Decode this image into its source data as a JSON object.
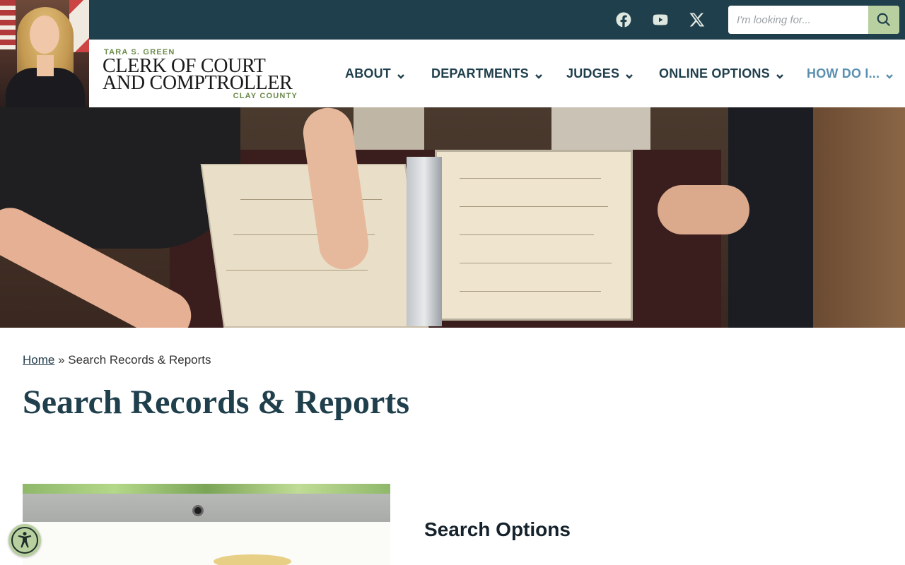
{
  "topbar": {
    "social": [
      {
        "name": "facebook-icon"
      },
      {
        "name": "youtube-icon"
      },
      {
        "name": "x-icon"
      }
    ],
    "search": {
      "placeholder": "I'm looking for...",
      "value": "",
      "button_icon": "search-icon"
    }
  },
  "header": {
    "portrait_icon": "clerk-portrait",
    "logo": {
      "name_line": "TARA S. GREEN",
      "title_line_1": "CLERK OF COURT",
      "title_line_2": "AND COMPTROLLER",
      "county_line": "CLAY COUNTY"
    },
    "nav": [
      {
        "label": "ABOUT",
        "icon": "chevron-down-icon"
      },
      {
        "label": "DEPARTMENTS",
        "icon": "chevron-down-icon"
      },
      {
        "label": "JUDGES",
        "icon": "chevron-down-icon"
      },
      {
        "label": "ONLINE OPTIONS",
        "icon": "chevron-down-icon"
      },
      {
        "label": "HOW DO I...",
        "icon": "chevron-down-icon",
        "active": true
      }
    ]
  },
  "breadcrumb": {
    "home": "Home",
    "separator": "»",
    "current": "Search Records & Reports"
  },
  "page": {
    "title": "Search Records & Reports",
    "section_heading": "Search Options"
  },
  "accessibility": {
    "icon": "accessibility-icon"
  },
  "colors": {
    "topbar_bg": "#203f4c",
    "accent_green": "#b8cfa0",
    "nav_text": "#203f4c",
    "nav_active": "#5b8fb0",
    "logo_green": "#6b8a4a"
  }
}
